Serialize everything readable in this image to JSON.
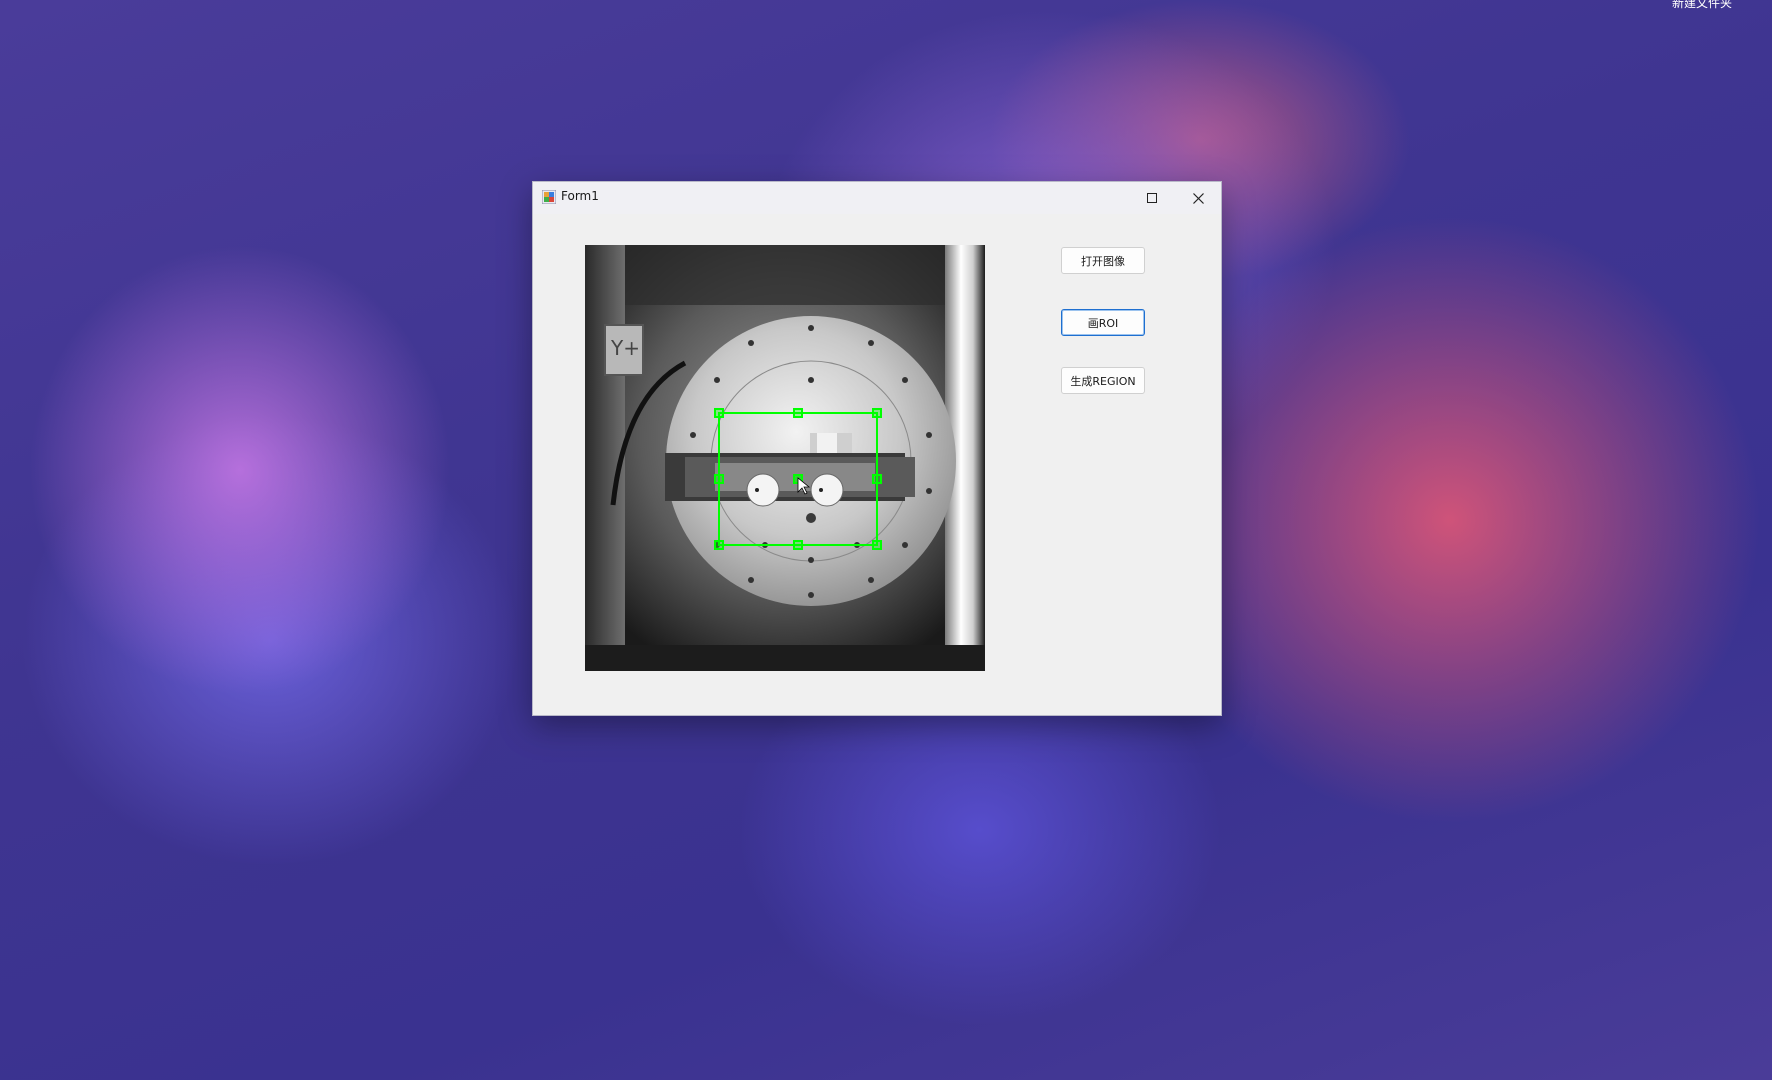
{
  "desktop": {
    "corner_label": "新建文件夹"
  },
  "window": {
    "title": "Form1",
    "icons": {
      "app": "form-app-icon",
      "maximize": "maximize-icon",
      "close": "close-icon"
    }
  },
  "buttons": {
    "open_image": "打开图像",
    "draw_roi": "画ROI",
    "generate_region": "生成REGION"
  },
  "image": {
    "description_icon": "camera-image",
    "roi_color": "#00ff00"
  }
}
